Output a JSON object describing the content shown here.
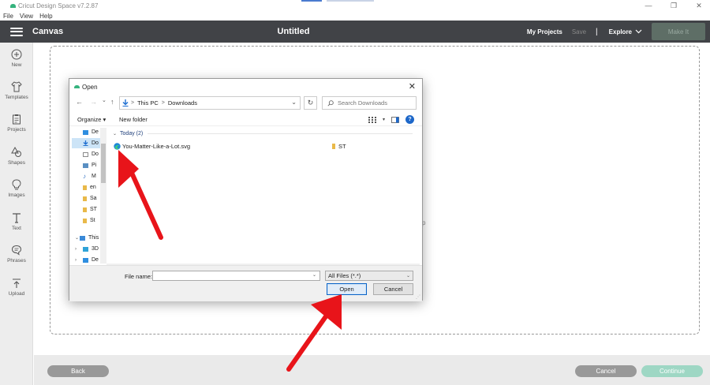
{
  "window": {
    "app_title": "Cricut Design Space  v7.2.87",
    "minimize_glyph": "—",
    "restore_glyph": "❐",
    "close_glyph": "✕"
  },
  "menu": [
    "File",
    "View",
    "Help"
  ],
  "header": {
    "canvas_label": "Canvas",
    "doc_title": "Untitled",
    "my_projects": "My Projects",
    "save": "Save",
    "separator": "|",
    "explore": "Explore",
    "make_it": "Make It"
  },
  "sidebar": {
    "items": [
      {
        "label": "New",
        "icon": "plus-circle-icon"
      },
      {
        "label": "Templates",
        "icon": "shirt-icon"
      },
      {
        "label": "Projects",
        "icon": "clipboard-icon"
      },
      {
        "label": "Shapes",
        "icon": "shapes-icon"
      },
      {
        "label": "Images",
        "icon": "lightbulb-icon"
      },
      {
        "label": "Text",
        "icon": "text-icon"
      },
      {
        "label": "Phrases",
        "icon": "speech-bubble-icon"
      },
      {
        "label": "Upload",
        "icon": "upload-icon"
      }
    ]
  },
  "canvas": {
    "ghost_text": "p"
  },
  "footer": {
    "back": "Back",
    "cancel": "Cancel",
    "continue": "Continue"
  },
  "dialog": {
    "title": "Open",
    "close": "✕",
    "nav": {
      "back": "←",
      "forward": "→",
      "recent": "⌄",
      "up": "↑",
      "path": [
        "This PC",
        "Downloads"
      ],
      "path_sep": ">",
      "refresh": "↻",
      "search_placeholder": "Search Downloads"
    },
    "toolbar": {
      "organize": "Organize ▾",
      "new_folder": "New folder",
      "help": "?"
    },
    "nav_pane": [
      {
        "label": "De",
        "icon": "desktop-icon",
        "color": "#2f8ee0"
      },
      {
        "label": "Do",
        "icon": "download-icon",
        "color": "#1f6fd1",
        "selected": true
      },
      {
        "label": "Do",
        "icon": "documents-icon",
        "color": "#8a8a8a"
      },
      {
        "label": "Pi",
        "icon": "pictures-icon",
        "color": "#5a8fc2"
      },
      {
        "label": "M",
        "icon": "music-icon",
        "color": "#2f6fc2"
      },
      {
        "label": "en",
        "icon": "folder-icon",
        "color": "#e9b949"
      },
      {
        "label": "Sa",
        "icon": "folder-icon",
        "color": "#e9b949"
      },
      {
        "label": "ST",
        "icon": "folder-icon",
        "color": "#e9b949"
      },
      {
        "label": "St",
        "icon": "folder-icon",
        "color": "#e9b949"
      },
      {
        "label": "This",
        "icon": "pc-icon",
        "color": "#3a8ad8",
        "caret": "⌄"
      },
      {
        "label": "3D",
        "icon": "3d-objects-icon",
        "color": "#2fa3d8",
        "caret": "›"
      },
      {
        "label": "De",
        "icon": "desktop-icon",
        "color": "#2f8ee0",
        "caret": "›"
      }
    ],
    "group_header": "Today (2)",
    "group_caret": "⌄",
    "files": [
      {
        "name": "You-Matter-Like-a-Lot.svg",
        "icon": "edge-icon"
      },
      {
        "name": "ST",
        "icon": "folder-icon"
      }
    ],
    "file_name_label": "File name:",
    "file_name_value": "",
    "filter_value": "All Files (*.*)",
    "open": "Open",
    "cancel": "Cancel"
  },
  "colors": {
    "header_bg": "#414347",
    "make_it_bg": "#5e6e66",
    "continue_bg": "#9ed7c4",
    "accent_blue": "#0a64c8",
    "arrow_red": "#e8141a"
  }
}
